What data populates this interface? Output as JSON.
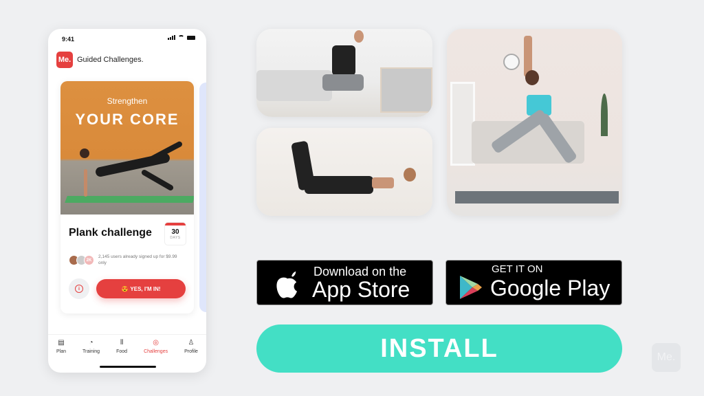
{
  "phone": {
    "status_time": "9:41",
    "app_logo": "Me.",
    "app_title": "Guided Challenges.",
    "challenge": {
      "hero_subtitle": "Strengthen",
      "hero_title": "YOUR CORE",
      "title": "Plank challenge",
      "days_number": "30",
      "days_label": "DAYS",
      "avatar_count_badge": "2K",
      "signup_text": "2,145 users already signed up for $9.99 only",
      "cta_emoji": "😍",
      "cta_label": "YES, I'M IN!",
      "info_icon": "i"
    },
    "tabs": [
      {
        "label": "Plan",
        "icon": "plan-icon",
        "glyph": "▤",
        "active": false
      },
      {
        "label": "Training",
        "icon": "training-icon",
        "glyph": "◔",
        "active": false
      },
      {
        "label": "Food",
        "icon": "food-icon",
        "glyph": "⫴",
        "active": false
      },
      {
        "label": "Challenges",
        "icon": "challenges-icon",
        "glyph": "◎",
        "active": true
      },
      {
        "label": "Profile",
        "icon": "profile-icon",
        "glyph": "♙",
        "active": false
      }
    ]
  },
  "stores": {
    "appstore_small": "Download on the",
    "appstore_big": "App Store",
    "googleplay_small": "GET IT ON",
    "googleplay_big": "Google Play"
  },
  "install_label": "INSTALL",
  "watermark": "Me.",
  "colors": {
    "brand_red": "#e5403f",
    "install_teal": "#43dfc5",
    "background": "#eff0f2"
  }
}
